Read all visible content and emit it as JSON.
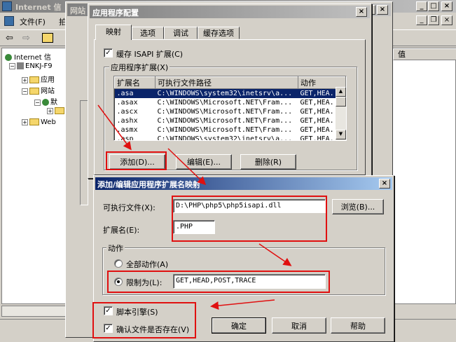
{
  "mmc": {
    "title": "Internet 信",
    "menu_file": "文件(F)",
    "menu_partial": "拍",
    "tree": {
      "root": "Internet 信",
      "server": "ENKJ-F9",
      "node_apppool": "应用",
      "node_sites": "网站",
      "node_default": "默",
      "node_web": "Web"
    },
    "right_header": "值"
  },
  "site_props": {
    "title": "网站"
  },
  "app_config": {
    "title": "应用程序配置",
    "tabs": [
      "映射",
      "选项",
      "调试",
      "缓存选项"
    ],
    "cache_isapi_label": "缓存 ISAPI 扩展(C)",
    "group_title": "应用程序扩展(X)",
    "columns": [
      "扩展名",
      "可执行文件路径",
      "动作"
    ],
    "rows": [
      {
        "ext": ".asa",
        "path": "C:\\WINDOWS\\system32\\inetsrv\\a...",
        "verbs": "GET,HEA..."
      },
      {
        "ext": ".asax",
        "path": "C:\\WINDOWS\\Microsoft.NET\\Fram...",
        "verbs": "GET,HEA..."
      },
      {
        "ext": ".ascx",
        "path": "C:\\WINDOWS\\Microsoft.NET\\Fram...",
        "verbs": "GET,HEA..."
      },
      {
        "ext": ".ashx",
        "path": "C:\\WINDOWS\\Microsoft.NET\\Fram...",
        "verbs": "GET,HEA..."
      },
      {
        "ext": ".asmx",
        "path": "C:\\WINDOWS\\Microsoft.NET\\Fram...",
        "verbs": "GET,HEA..."
      },
      {
        "ext": ".asp",
        "path": "C:\\WINDOWS\\system32\\inetsrv\\a...",
        "verbs": "GET,HEA..."
      }
    ],
    "add_button": "添加(D)...",
    "edit_button": "编辑(E)...",
    "delete_button": "删除(R)"
  },
  "ext_dialog": {
    "title": "添加/编辑应用程序扩展名映射",
    "exe_label": "可执行文件(X):",
    "exe_value": "D:\\PHP\\php5\\php5isapi.dll",
    "browse_button": "浏览(B)...",
    "ext_label": "扩展名(E):",
    "ext_value": ".PHP",
    "verbs_group": "动作",
    "all_verbs_label": "全部动作(A)",
    "limit_label": "限制为(L):",
    "limit_value": "GET,HEAD,POST,TRACE",
    "script_engine_label": "脚本引擎(S)",
    "verify_file_label": "确认文件是否存在(V)",
    "ok_button": "确定",
    "cancel_button": "取消",
    "help_button": "帮助"
  },
  "colors": {
    "title_active": "#0a246a",
    "face": "#d4d0c8",
    "highlight_red": "#e01010"
  }
}
